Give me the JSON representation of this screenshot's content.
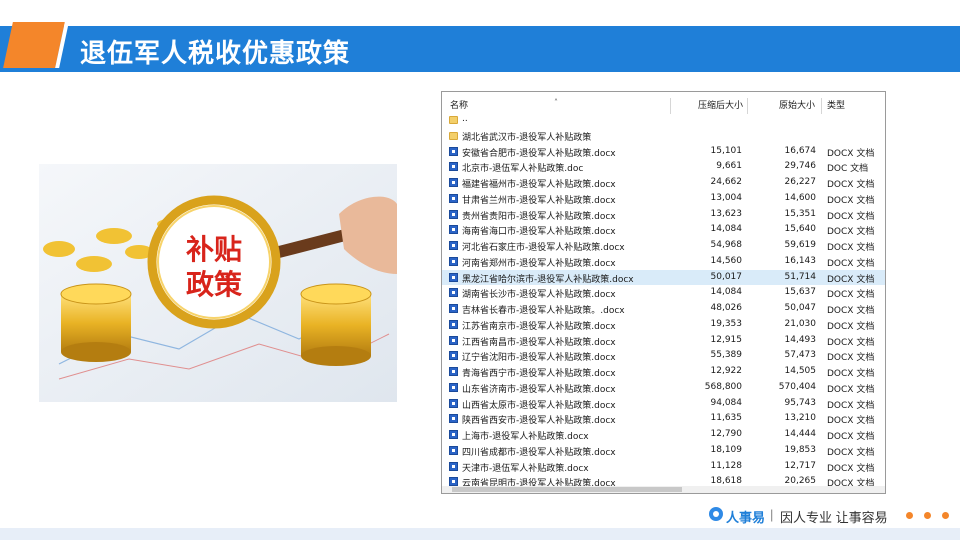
{
  "slide": {
    "title": "退伍军人税收优惠政策",
    "accent_color": "#f4862a",
    "banner_color": "#1f7fd8"
  },
  "photo": {
    "sign_line1": "补贴",
    "sign_line2": "政策"
  },
  "file_list": {
    "columns": {
      "name": "名称",
      "compressed": "压缩后大小",
      "original": "原始大小",
      "type": "类型"
    },
    "rows": [
      {
        "name": "..",
        "compressed": "",
        "original": "",
        "type": "",
        "icon": "folder-icon"
      },
      {
        "name": "湖北省武汉市-退役军人补贴政策",
        "compressed": "",
        "original": "",
        "type": "",
        "icon": "folder-icon"
      },
      {
        "name": "安徽省合肥市-退役军人补贴政策.docx",
        "compressed": "15,101",
        "original": "16,674",
        "type": "DOCX 文档",
        "icon": "word-doc-icon"
      },
      {
        "name": "北京市-退伍军人补贴政策.doc",
        "compressed": "9,661",
        "original": "29,746",
        "type": "DOC 文档",
        "icon": "word-doc-icon"
      },
      {
        "name": "福建省福州市-退役军人补贴政策.docx",
        "compressed": "24,662",
        "original": "26,227",
        "type": "DOCX 文档",
        "icon": "word-doc-icon"
      },
      {
        "name": "甘肃省兰州市-退役军人补贴政策.docx",
        "compressed": "13,004",
        "original": "14,600",
        "type": "DOCX 文档",
        "icon": "word-doc-icon"
      },
      {
        "name": "贵州省贵阳市-退役军人补贴政策.docx",
        "compressed": "13,623",
        "original": "15,351",
        "type": "DOCX 文档",
        "icon": "word-doc-icon"
      },
      {
        "name": "海南省海口市-退役军人补贴政策.docx",
        "compressed": "14,084",
        "original": "15,640",
        "type": "DOCX 文档",
        "icon": "word-doc-icon"
      },
      {
        "name": "河北省石家庄市-退役军人补贴政策.docx",
        "compressed": "54,968",
        "original": "59,619",
        "type": "DOCX 文档",
        "icon": "word-doc-icon"
      },
      {
        "name": "河南省郑州市-退役军人补贴政策.docx",
        "compressed": "14,560",
        "original": "16,143",
        "type": "DOCX 文档",
        "icon": "word-doc-icon"
      },
      {
        "name": "黑龙江省哈尔滨市-退役军人补贴政策.docx",
        "compressed": "50,017",
        "original": "51,714",
        "type": "DOCX 文档",
        "icon": "word-doc-icon",
        "selected": true
      },
      {
        "name": "湖南省长沙市-退役军人补贴政策.docx",
        "compressed": "14,084",
        "original": "15,637",
        "type": "DOCX 文档",
        "icon": "word-doc-icon"
      },
      {
        "name": "吉林省长春市-退役军人补贴政策。.docx",
        "compressed": "48,026",
        "original": "50,047",
        "type": "DOCX 文档",
        "icon": "word-doc-icon"
      },
      {
        "name": "江苏省南京市-退役军人补贴政策.docx",
        "compressed": "19,353",
        "original": "21,030",
        "type": "DOCX 文档",
        "icon": "word-doc-icon"
      },
      {
        "name": "江西省南昌市-退役军人补贴政策.docx",
        "compressed": "12,915",
        "original": "14,493",
        "type": "DOCX 文档",
        "icon": "word-doc-icon"
      },
      {
        "name": "辽宁省沈阳市-退役军人补贴政策.docx",
        "compressed": "55,389",
        "original": "57,473",
        "type": "DOCX 文档",
        "icon": "word-doc-icon"
      },
      {
        "name": "青海省西宁市-退役军人补贴政策.docx",
        "compressed": "12,922",
        "original": "14,505",
        "type": "DOCX 文档",
        "icon": "word-doc-icon"
      },
      {
        "name": "山东省济南市-退役军人补贴政策.docx",
        "compressed": "568,800",
        "original": "570,404",
        "type": "DOCX 文档",
        "icon": "word-doc-icon"
      },
      {
        "name": "山西省太原市-退役军人补贴政策.docx",
        "compressed": "94,084",
        "original": "95,743",
        "type": "DOCX 文档",
        "icon": "word-doc-icon"
      },
      {
        "name": "陕西省西安市-退役军人补贴政策.docx",
        "compressed": "11,635",
        "original": "13,210",
        "type": "DOCX 文档",
        "icon": "word-doc-icon"
      },
      {
        "name": "上海市-退役军人补贴政策.docx",
        "compressed": "12,790",
        "original": "14,444",
        "type": "DOCX 文档",
        "icon": "word-doc-icon"
      },
      {
        "name": "四川省成都市-退役军人补贴政策.docx",
        "compressed": "18,109",
        "original": "19,853",
        "type": "DOCX 文档",
        "icon": "word-doc-icon"
      },
      {
        "name": "天津市-退伍军人补贴政策.docx",
        "compressed": "11,128",
        "original": "12,717",
        "type": "DOCX 文档",
        "icon": "word-doc-icon"
      },
      {
        "name": "云南省昆明市-退役军人补贴政策.docx",
        "compressed": "18,618",
        "original": "20,265",
        "type": "DOCX 文档",
        "icon": "word-doc-icon"
      }
    ]
  },
  "footer": {
    "brand": "人事易",
    "separator": "|",
    "slogan": "因人专业 让事容易"
  }
}
